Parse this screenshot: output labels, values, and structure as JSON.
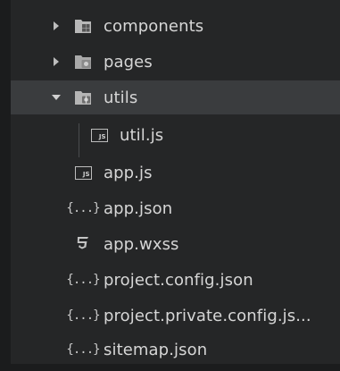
{
  "tree": {
    "items": [
      {
        "label": "components",
        "kind": "folder",
        "icon": "folder-icon",
        "expanded": false,
        "level": 0
      },
      {
        "label": "pages",
        "kind": "folder",
        "icon": "folder-icon",
        "expanded": false,
        "level": 0
      },
      {
        "label": "utils",
        "kind": "folder",
        "icon": "folder-open-icon",
        "expanded": true,
        "level": 0,
        "selected": true
      },
      {
        "label": "util.js",
        "kind": "js",
        "icon": "js-file-icon",
        "level": 1
      },
      {
        "label": "app.js",
        "kind": "js",
        "icon": "js-file-icon",
        "level": 0
      },
      {
        "label": "app.json",
        "kind": "json",
        "icon": "json-file-icon",
        "level": 0
      },
      {
        "label": "app.wxss",
        "kind": "css",
        "icon": "css-file-icon",
        "level": 0
      },
      {
        "label": "project.config.json",
        "kind": "json",
        "icon": "json-file-icon",
        "level": 0
      },
      {
        "label": "project.private.config.js...",
        "kind": "json",
        "icon": "json-file-icon",
        "level": 0
      },
      {
        "label": "sitemap.json",
        "kind": "json",
        "icon": "json-file-icon",
        "level": 0
      }
    ],
    "json_icon_text": "{...}",
    "js_icon_text": "JS"
  },
  "colors": {
    "background": "#252627",
    "selected_row": "#3a3c3e",
    "text": "#d6d6d6",
    "icon": "#bfbfbf"
  }
}
